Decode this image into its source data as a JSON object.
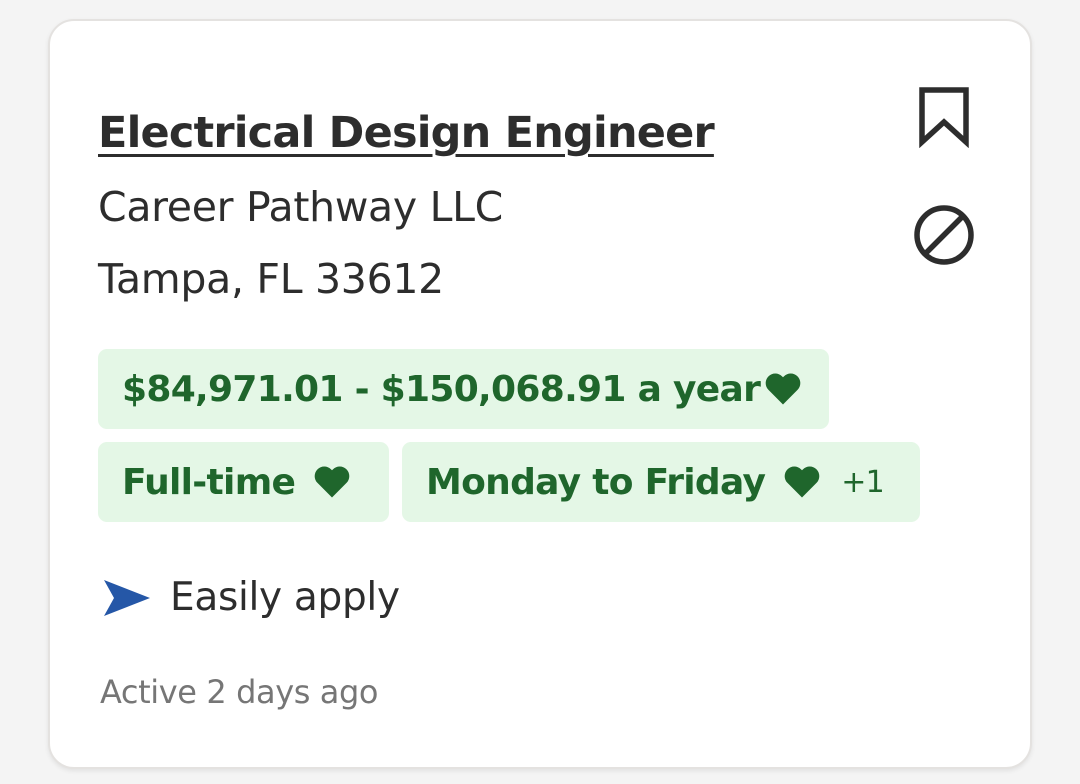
{
  "job": {
    "title": "Electrical Design Engineer",
    "company": "Career Pathway LLC",
    "location": "Tampa, FL 33612",
    "tags": {
      "salary": "$84,971.01 - $150,068.91 a year",
      "job_type": "Full-time",
      "schedule": "Monday to Friday",
      "more_count": "+1"
    },
    "easy_apply": "Easily apply",
    "posted": "Active 2 days ago"
  },
  "icons": {
    "save": "bookmark-icon",
    "dismiss": "not-interested-icon",
    "match": "heart-icon",
    "apply": "send-arrow-icon"
  },
  "colors": {
    "tag_background": "#e4f7e6",
    "tag_text": "#1f662c",
    "apply_icon": "#2557a7",
    "title_text": "#2d2d2d",
    "muted_text": "#767676"
  }
}
